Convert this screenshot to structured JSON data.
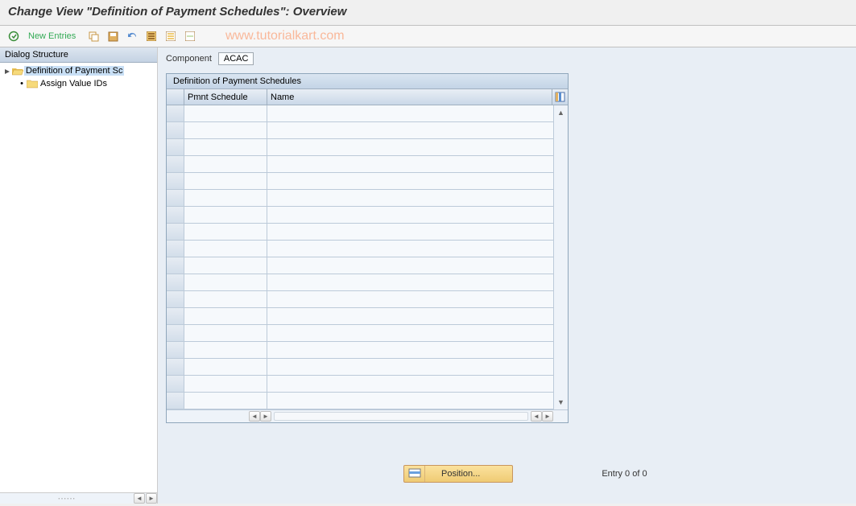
{
  "title": "Change View \"Definition of Payment Schedules\": Overview",
  "toolbar": {
    "new_entries_label": "New Entries"
  },
  "watermark": "www.tutorialkart.com",
  "sidebar": {
    "title": "Dialog Structure",
    "items": [
      {
        "label": "Definition of Payment Sc",
        "selected": true,
        "level": 0,
        "open_folder": true
      },
      {
        "label": "Assign Value IDs",
        "selected": false,
        "level": 1,
        "open_folder": false
      }
    ]
  },
  "component": {
    "label": "Component",
    "value": "ACAC"
  },
  "table": {
    "title": "Definition of Payment Schedules",
    "columns": [
      "Pmnt Schedule",
      "Name"
    ],
    "rows": [
      {
        "pmnt_schedule": "",
        "name": ""
      },
      {
        "pmnt_schedule": "",
        "name": ""
      },
      {
        "pmnt_schedule": "",
        "name": ""
      },
      {
        "pmnt_schedule": "",
        "name": ""
      },
      {
        "pmnt_schedule": "",
        "name": ""
      },
      {
        "pmnt_schedule": "",
        "name": ""
      },
      {
        "pmnt_schedule": "",
        "name": ""
      },
      {
        "pmnt_schedule": "",
        "name": ""
      },
      {
        "pmnt_schedule": "",
        "name": ""
      },
      {
        "pmnt_schedule": "",
        "name": ""
      },
      {
        "pmnt_schedule": "",
        "name": ""
      },
      {
        "pmnt_schedule": "",
        "name": ""
      },
      {
        "pmnt_schedule": "",
        "name": ""
      },
      {
        "pmnt_schedule": "",
        "name": ""
      },
      {
        "pmnt_schedule": "",
        "name": ""
      },
      {
        "pmnt_schedule": "",
        "name": ""
      },
      {
        "pmnt_schedule": "",
        "name": ""
      },
      {
        "pmnt_schedule": "",
        "name": ""
      }
    ]
  },
  "footer": {
    "position_label": "Position...",
    "entry_text": "Entry 0 of 0"
  }
}
